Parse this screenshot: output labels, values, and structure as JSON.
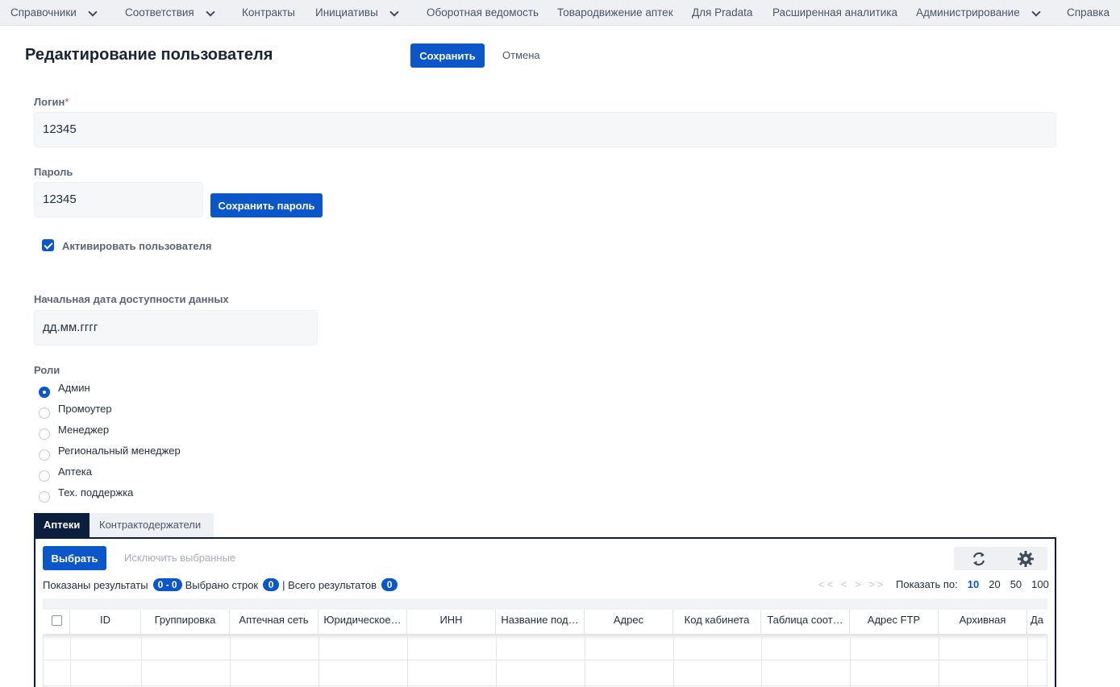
{
  "nav": {
    "items": [
      {
        "label": "Справочники"
      },
      {
        "label": "Соответствия"
      },
      {
        "label": "Контракты"
      },
      {
        "label": "Инициативы"
      },
      {
        "label": "Оборотная ведомость"
      },
      {
        "label": "Товародвижение аптек"
      },
      {
        "label": "Для Pradata"
      },
      {
        "label": "Расширенная аналитика"
      },
      {
        "label": "Администрирование"
      },
      {
        "label": "Справка"
      }
    ]
  },
  "header": {
    "title": "Редактирование пользователя",
    "save_label": "Сохранить",
    "cancel_label": "Отмена"
  },
  "form": {
    "login_label": "Логин",
    "login_required_mark": "*",
    "login_value": "12345",
    "password_label": "Пароль",
    "password_value": "12345",
    "save_password_label": "Сохранить пароль",
    "activate_label": "Активировать пользователя",
    "activate_checked": true,
    "start_date_label": "Начальная дата доступности данных",
    "start_date_placeholder": "дд.мм.гггг",
    "roles_label": "Роли",
    "roles": [
      {
        "label": "Админ",
        "selected": true
      },
      {
        "label": "Промоутер",
        "selected": false
      },
      {
        "label": "Менеджер",
        "selected": false
      },
      {
        "label": "Региональный менеджер",
        "selected": false
      },
      {
        "label": "Аптека",
        "selected": false
      },
      {
        "label": "Тех. поддержка",
        "selected": false
      }
    ]
  },
  "tabs": [
    {
      "label": "Аптеки",
      "active": true
    },
    {
      "label": "Контрактодержатели",
      "active": false
    }
  ],
  "table": {
    "select_label": "Выбрать",
    "exclude_label": "Исключить выбранные",
    "shown_label": "Показаны результаты",
    "shown_value": "0 - 0",
    "selected_label": "Выбрано строк",
    "selected_value": "0",
    "total_label": "| Всего результатов",
    "total_value": "0",
    "pager_nav": "<< < > >>",
    "page_size_label": "Показать по:",
    "page_sizes": [
      "10",
      "20",
      "50",
      "100"
    ],
    "active_page_size": "10",
    "columns": [
      "ID",
      "Группировка",
      "Аптечная сеть",
      "Юридическое…",
      "ИНН",
      "Название под…",
      "Адрес",
      "Код кабинета",
      "Таблица соот…",
      "Адрес FTP",
      "Архивная",
      "Да"
    ]
  },
  "icons": {
    "refresh": "refresh-icon",
    "settings": "gear-icon"
  },
  "colors": {
    "primary": "#0b56c9",
    "tab_active": "#0c1e3d",
    "nav_bg": "#eef0f4"
  }
}
